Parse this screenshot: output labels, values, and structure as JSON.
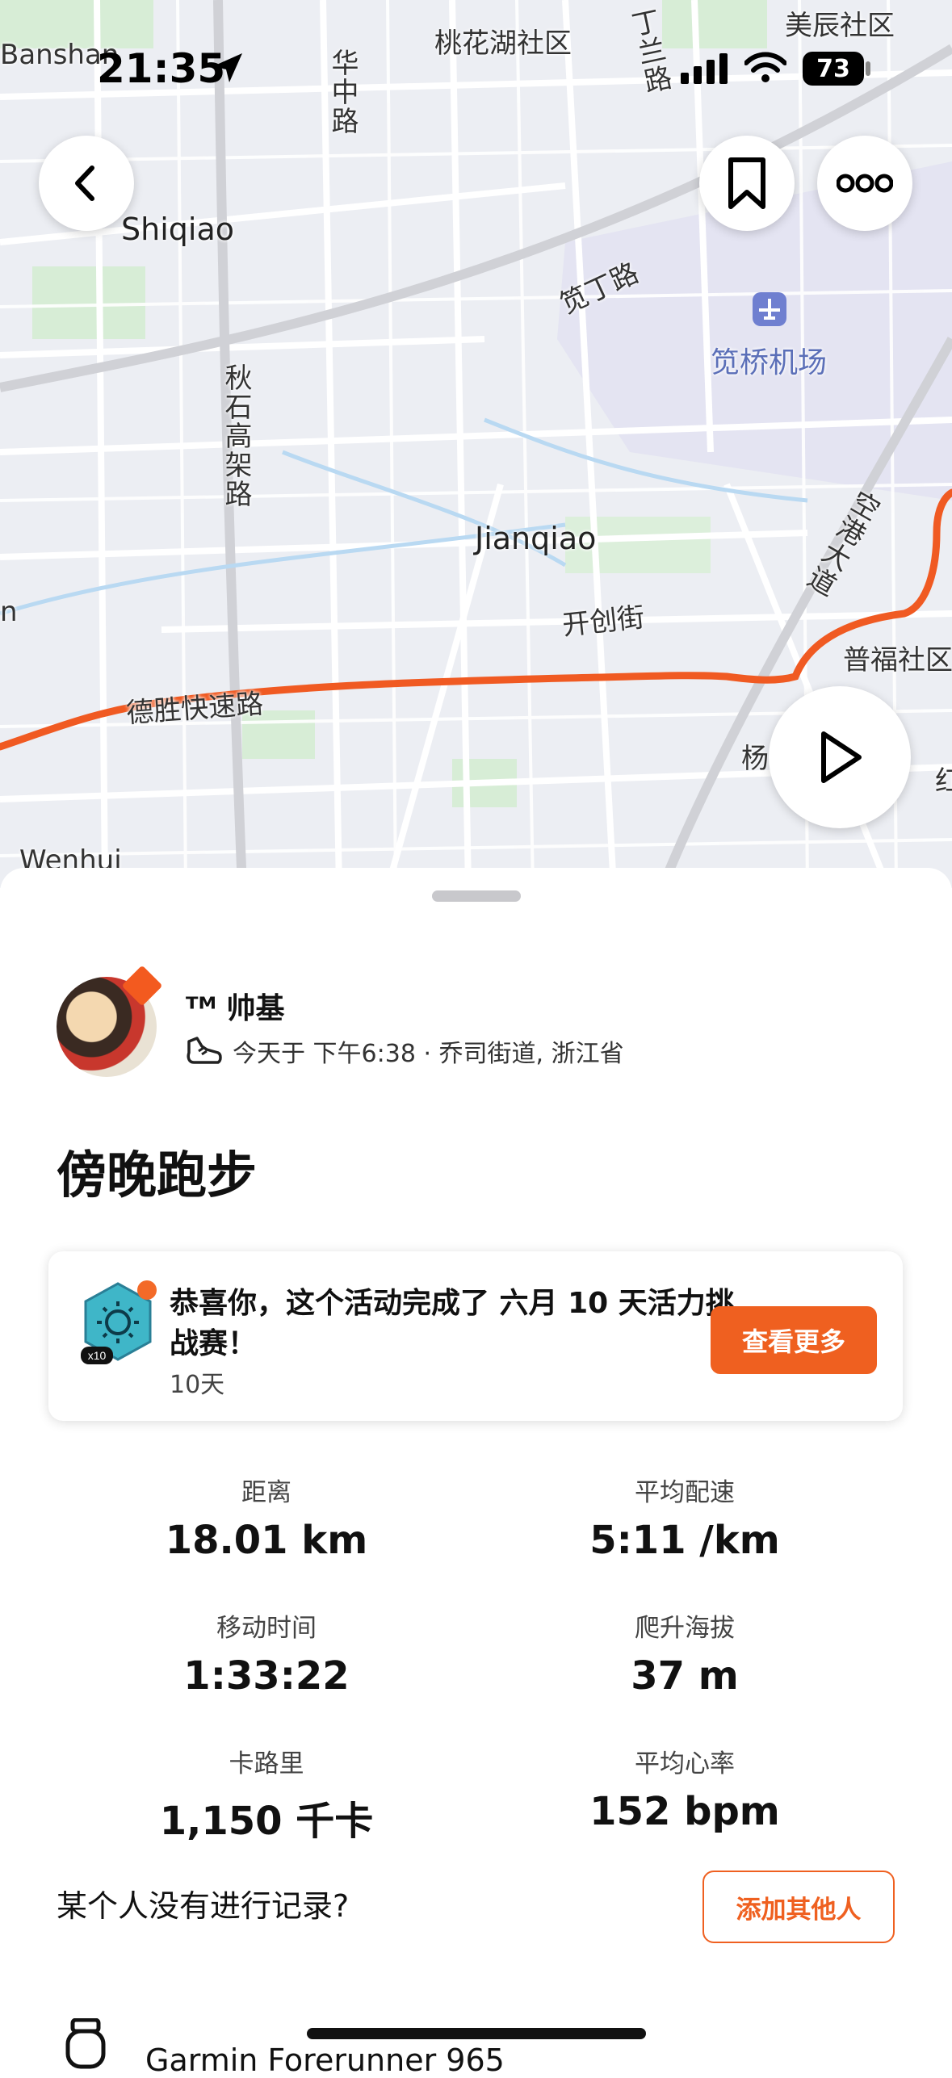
{
  "status_bar": {
    "time": "21:35",
    "battery": "73"
  },
  "map": {
    "labels": {
      "banshan": "Banshan",
      "taohuahu": "桃花湖社区",
      "meichen": "美辰社区",
      "huazhong": "华中路",
      "dinglan": "丁兰路",
      "shiqiao": "Shiqiao",
      "jianding": "笕丁路",
      "airport": "笕桥机场",
      "qiushi": "秋石高架路",
      "jianqiao": "Jianqiao",
      "kaichuang": "开创街",
      "konggang": "空港大道",
      "pufu": "普福社区",
      "desheng": "德胜快速路",
      "yang": "杨",
      "n": "n",
      "wenhui": "Wenhui",
      "hong": "红"
    }
  },
  "buttons": {
    "back": "back",
    "bookmark": "bookmark",
    "more": "more",
    "play": "play"
  },
  "activity": {
    "athlete": "ᵀᴹ 帅基",
    "meta": "今天于 下午6:38 · 乔司街道, 浙江省",
    "title": "傍晚跑步"
  },
  "challenge": {
    "text": "恭喜你，这个活动完成了 六月 10 天活力挑战赛！",
    "sub": "10天",
    "button": "查看更多",
    "badge_label": "x10"
  },
  "stats": [
    {
      "label": "距离",
      "value": "18.01 km"
    },
    {
      "label": "平均配速",
      "value": "5:11 /km"
    },
    {
      "label": "移动时间",
      "value": "1:33:22"
    },
    {
      "label": "爬升海拔",
      "value": "37 m"
    },
    {
      "label": "卡路里",
      "value": "1,150 千卡"
    },
    {
      "label": "平均心率",
      "value": "152 bpm"
    }
  ],
  "social": {
    "question": "某个人没有进行记录?",
    "add_button": "添加其他人"
  },
  "device": {
    "name": "Garmin Forerunner 965"
  },
  "colors": {
    "accent": "#ef6020",
    "route": "#f05a22"
  }
}
